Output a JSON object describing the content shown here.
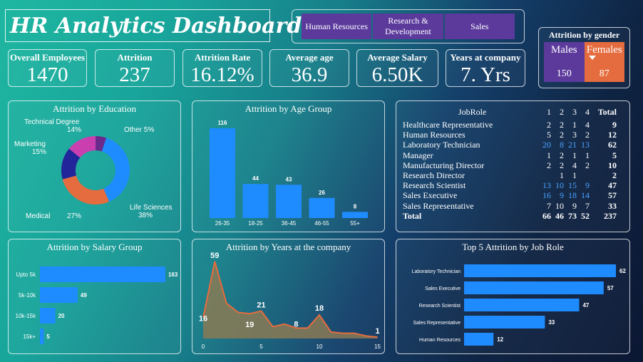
{
  "title": "HR Analytics Dashboard",
  "slicer": [
    "Human Resources",
    "Research & Development",
    "Sales"
  ],
  "kpis": [
    {
      "label": "Overall Employees",
      "value": "1470"
    },
    {
      "label": "Attrition",
      "value": "237"
    },
    {
      "label": "Attrition Rate",
      "value": "16.12%"
    },
    {
      "label": "Average age",
      "value": "36.9"
    },
    {
      "label": "Average Salary",
      "value": "6.50K"
    },
    {
      "label": "Years at company",
      "value": "7. Yrs"
    }
  ],
  "gender": {
    "title": "Attrition by gender",
    "males_label": "Males",
    "males_value": "150",
    "females_label": "Females",
    "females_value": "87"
  },
  "panels": {
    "education": "Attrition by Education",
    "age": "Attrition by Age Group",
    "salary": "Attrition by Salary Group",
    "years": "Attrition by Years at the company",
    "top5": "Top 5 Attrition by Job Role"
  },
  "jobrole": {
    "headers": [
      "JobRole",
      "1",
      "2",
      "3",
      "4",
      "Total"
    ],
    "rows": [
      {
        "role": "Healthcare Representative",
        "v": [
          "2",
          "2",
          "1",
          "4"
        ],
        "total": "9"
      },
      {
        "role": "Human Resources",
        "v": [
          "5",
          "2",
          "3",
          "2"
        ],
        "total": "12"
      },
      {
        "role": "Laboratory Technician",
        "v": [
          "20",
          "8",
          "21",
          "13"
        ],
        "total": "62"
      },
      {
        "role": "Manager",
        "v": [
          "1",
          "2",
          "1",
          "1"
        ],
        "total": "5"
      },
      {
        "role": "Manufacturing Director",
        "v": [
          "2",
          "2",
          "4",
          "2"
        ],
        "total": "10"
      },
      {
        "role": "Research Director",
        "v": [
          "",
          "1",
          "1",
          ""
        ],
        "total": "2"
      },
      {
        "role": "Research Scientist",
        "v": [
          "13",
          "10",
          "15",
          "9"
        ],
        "total": "47"
      },
      {
        "role": "Sales Executive",
        "v": [
          "16",
          "9",
          "18",
          "14"
        ],
        "total": "57"
      },
      {
        "role": "Sales Representative",
        "v": [
          "7",
          "10",
          "9",
          "7"
        ],
        "total": "33"
      },
      {
        "role": "Total",
        "v": [
          "66",
          "46",
          "73",
          "52"
        ],
        "total": "237"
      }
    ]
  },
  "colors": {
    "bar": "#1e8bff",
    "purple": "#5b3a9c",
    "orange": "#e56c3e"
  },
  "chart_data": [
    {
      "type": "pie",
      "title": "Attrition by Education",
      "categories": [
        "Life Sciences",
        "Medical",
        "Marketing",
        "Technical Degree",
        "Other"
      ],
      "values": [
        38,
        27,
        15,
        14,
        5
      ],
      "labels": [
        "Life Sciences 38%",
        "Medical 27%",
        "Marketing 15%",
        "Technical Degree 14%",
        "Other 5%"
      ],
      "colors": [
        "#1e8bff",
        "#e56c3e",
        "#22259a",
        "#c93fb0",
        "#6a2a8c"
      ]
    },
    {
      "type": "bar",
      "title": "Attrition by Age Group",
      "categories": [
        "26-35",
        "18-25",
        "36-45",
        "46-55",
        "55+"
      ],
      "values": [
        116,
        44,
        43,
        26,
        8
      ]
    },
    {
      "type": "bar",
      "orientation": "horizontal",
      "title": "Attrition by Salary Group",
      "categories": [
        "Upto 5k",
        "5k-10k",
        "10k-15k",
        "15k+"
      ],
      "values": [
        163,
        49,
        20,
        5
      ]
    },
    {
      "type": "area",
      "title": "Attrition by Years at the company",
      "x": [
        0,
        1,
        2,
        3,
        4,
        5,
        6,
        7,
        8,
        9,
        10,
        11,
        12,
        13,
        14,
        15
      ],
      "values": [
        16,
        59,
        27,
        20,
        19,
        21,
        9,
        11,
        8,
        8,
        18,
        5,
        4,
        4,
        2,
        1
      ],
      "labeled_points": [
        0,
        1,
        4,
        5,
        8,
        10,
        15
      ],
      "xticks": [
        0,
        5,
        10,
        15
      ]
    },
    {
      "type": "bar",
      "orientation": "horizontal",
      "title": "Top 5 Attrition by Job Role",
      "categories": [
        "Laboratory Technician",
        "Sales Executive",
        "Research Scientist",
        "Sales Representative",
        "Human Resources"
      ],
      "values": [
        62,
        57,
        47,
        33,
        12
      ]
    }
  ]
}
